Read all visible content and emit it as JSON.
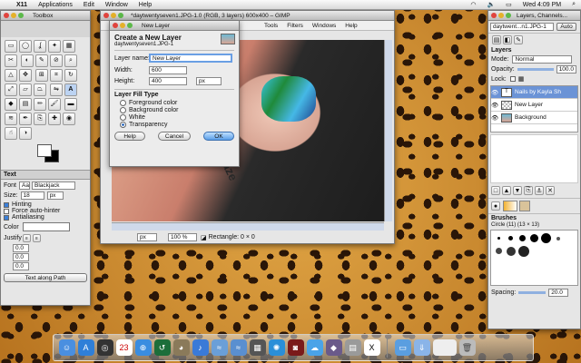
{
  "menubar": {
    "app": "X11",
    "items": [
      "Applications",
      "Edit",
      "Window",
      "Help"
    ],
    "clock": "Wed 4:09 PM"
  },
  "toolbox": {
    "title": "Toolbox",
    "text_options_title": "Text",
    "font_label": "Font",
    "font_value": "Blackjack",
    "size_label": "Size:",
    "size_value": "18",
    "size_unit": "px",
    "hinting": "Hinting",
    "force_autohinter": "Force auto-hinter",
    "antialiasing": "Antialiasing",
    "color_label": "Color",
    "justify_label": "Justify",
    "indent_value": "0.0",
    "line_spacing_value": "0.0",
    "letter_spacing_value": "0.0",
    "text_along_path": "Text along Path"
  },
  "image_window": {
    "title": "*daytwentyseven1.JPG-1.0 (RGB, 3 layers) 600x400 – GIMP",
    "menus": [
      "Tools",
      "Filters",
      "Windows",
      "Help"
    ],
    "zoom_unit": "px",
    "zoom_value": "100 %",
    "status": "Rectangle: 0 × 0",
    "canvas_text": "china glaze"
  },
  "new_layer_dialog": {
    "window_title": "New Layer",
    "heading": "Create a New Layer",
    "subheading": "daytwentyseven1.JPG-1",
    "layer_name_label": "Layer name:",
    "layer_name_value": "New Layer",
    "width_label": "Width:",
    "width_value": "600",
    "height_label": "Height:",
    "height_value": "400",
    "unit": "px",
    "fill_type_title": "Layer Fill Type",
    "fill_options": [
      "Foreground color",
      "Background color",
      "White",
      "Transparency"
    ],
    "help_button": "Help",
    "cancel_button": "Cancel",
    "ok_button": "OK"
  },
  "layers_panel": {
    "title": "Layers, Channels...",
    "image_select": "daytwent...n1.JPG-1",
    "auto_button": "Auto",
    "tab_label": "Layers",
    "mode_label": "Mode:",
    "mode_value": "Normal",
    "opacity_label": "Opacity:",
    "opacity_value": "100.0",
    "lock_label": "Lock:",
    "layers": [
      "Nails by Kayla Sh",
      "New Layer",
      "Background"
    ],
    "brushes_title": "Brushes",
    "brush_name": "Circle (11) (13 × 13)",
    "spacing_label": "Spacing:",
    "spacing_value": "20.0"
  }
}
